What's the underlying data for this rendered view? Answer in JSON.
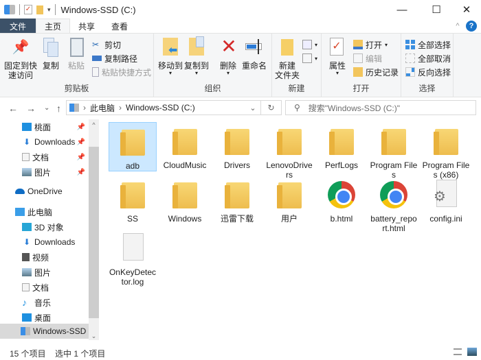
{
  "window": {
    "title": "Windows-SSD (C:)",
    "minimize": "—",
    "maximize": "☐",
    "close": "✕"
  },
  "ribbon_tabs": [
    {
      "label": "文件"
    },
    {
      "label": "主页"
    },
    {
      "label": "共享"
    },
    {
      "label": "查看"
    }
  ],
  "ribbon": {
    "collapse_icon": "^",
    "help_icon": "?",
    "clipboard": {
      "group_label": "剪贴板",
      "pin_label_1": "固定到快",
      "pin_label_2": "速访问",
      "copy": "复制",
      "paste": "粘贴",
      "cut": "剪切",
      "copy_path": "复制路径",
      "paste_shortcut": "粘贴快捷方式"
    },
    "organize": {
      "group_label": "组织",
      "move_to": "移动到",
      "copy_to": "复制到",
      "delete": "删除",
      "rename": "重命名"
    },
    "new": {
      "group_label": "新建",
      "new_folder_1": "新建",
      "new_folder_2": "文件夹"
    },
    "open": {
      "group_label": "打开",
      "properties": "属性",
      "open": "打开",
      "edit": "编辑",
      "history": "历史记录"
    },
    "select": {
      "group_label": "选择",
      "select_all": "全部选择",
      "select_none": "全部取消",
      "invert": "反向选择"
    }
  },
  "nav": {
    "back": "←",
    "forward": "→",
    "recent": "⌄",
    "up": "↑",
    "breadcrumb": [
      "此电脑",
      "Windows-SSD (C:)"
    ],
    "sep": "›",
    "dropdown": "⌄",
    "refresh": "↻",
    "search_placeholder": "搜索\"Windows-SSD (C:)\""
  },
  "sidebar": {
    "items": [
      {
        "label": "桃面",
        "icon": "desktop-icon",
        "pinned": true
      },
      {
        "label": "Downloads",
        "icon": "downloads-icon",
        "pinned": true
      },
      {
        "label": "文档",
        "icon": "documents-icon",
        "pinned": true
      },
      {
        "label": "图片",
        "icon": "pictures-icon",
        "pinned": true
      },
      {
        "label": "OneDrive",
        "icon": "onedrive-icon"
      },
      {
        "label": "此电脑",
        "icon": "this-pc-icon"
      },
      {
        "label": "3D 对象",
        "icon": "3d-objects-icon"
      },
      {
        "label": "Downloads",
        "icon": "downloads-icon"
      },
      {
        "label": "视频",
        "icon": "videos-icon"
      },
      {
        "label": "图片",
        "icon": "pictures-icon"
      },
      {
        "label": "文档",
        "icon": "documents-icon"
      },
      {
        "label": "音乐",
        "icon": "music-icon"
      },
      {
        "label": "桌面",
        "icon": "desktop-icon"
      },
      {
        "label": "Windows-SSD (",
        "icon": "drive-icon",
        "selected": true
      }
    ]
  },
  "files": [
    {
      "name": "adb",
      "type": "folder",
      "selected": true
    },
    {
      "name": "CloudMusic",
      "type": "folder"
    },
    {
      "name": "Drivers",
      "type": "folder"
    },
    {
      "name": "LenovoDrivers",
      "type": "folder"
    },
    {
      "name": "PerfLogs",
      "type": "folder"
    },
    {
      "name": "Program Files",
      "type": "folder"
    },
    {
      "name": "Program Files (x86)",
      "type": "folder"
    },
    {
      "name": "SS",
      "type": "folder"
    },
    {
      "name": "Windows",
      "type": "folder"
    },
    {
      "name": "迅雷下载",
      "type": "folder"
    },
    {
      "name": "用户",
      "type": "folder"
    },
    {
      "name": "b.html",
      "type": "chrome-html"
    },
    {
      "name": "battery_report.html",
      "type": "chrome-html"
    },
    {
      "name": "config.ini",
      "type": "ini"
    },
    {
      "name": "OnKeyDetector.log",
      "type": "log"
    }
  ],
  "status": {
    "count": "15 个项目",
    "selected": "选中 1 个项目"
  }
}
